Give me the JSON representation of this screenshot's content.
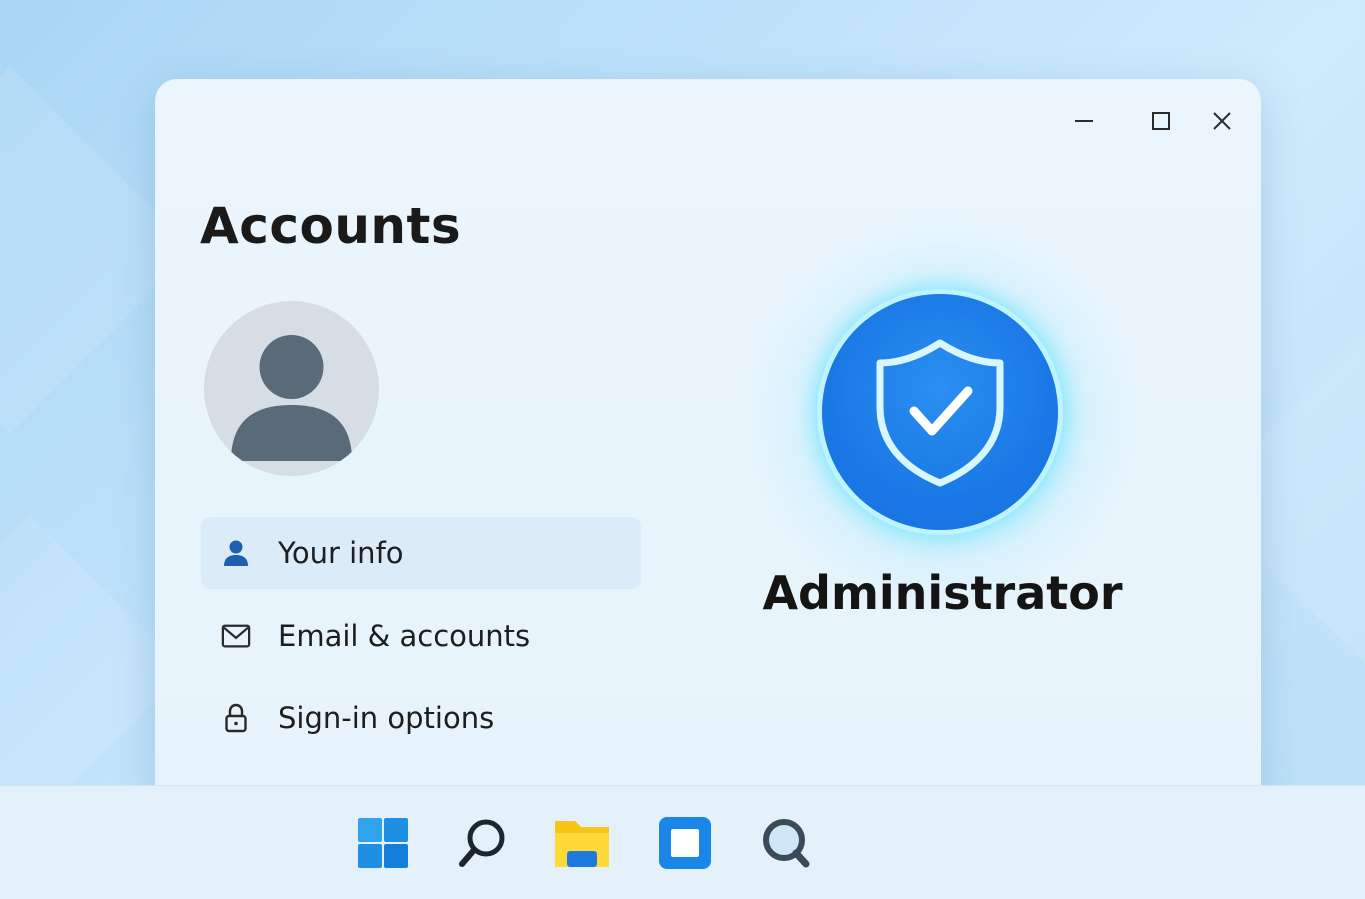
{
  "window": {
    "title": "Accounts",
    "controls": {
      "minimize_icon": "minimize-icon",
      "maximize_icon": "maximize-icon",
      "close_icon": "close-icon"
    }
  },
  "profile": {
    "avatar_icon": "user-avatar-icon"
  },
  "nav": {
    "items": [
      {
        "label": "Your info",
        "icon": "person-icon",
        "selected": true
      },
      {
        "label": "Email & accounts",
        "icon": "mail-icon",
        "selected": false
      },
      {
        "label": "Sign-in options",
        "icon": "lock-icon",
        "selected": false
      }
    ]
  },
  "account": {
    "role": "Administrator",
    "badge_icon": "shield-check-icon"
  },
  "taskbar": {
    "items": [
      {
        "icon": "windows-start-icon"
      },
      {
        "icon": "search-icon"
      },
      {
        "icon": "file-explorer-icon"
      },
      {
        "icon": "app-window-icon"
      },
      {
        "icon": "search-app-icon"
      }
    ]
  },
  "colors": {
    "accent": "#1a78e6",
    "glow": "#5adcff",
    "selected_bg": "#dcebf8",
    "icon_blue": "#1f5fb0"
  }
}
